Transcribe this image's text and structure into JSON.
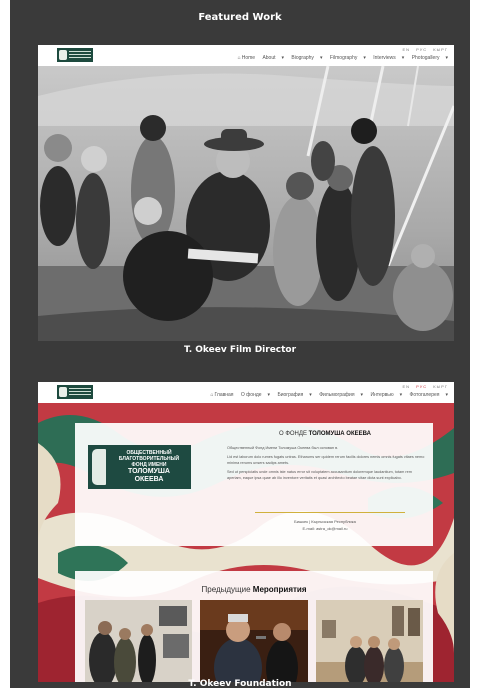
{
  "section_title": "Featured Work",
  "projects": [
    {
      "caption": "T. Okeev Film Director",
      "languages": [
        "EN",
        "РУС",
        "КЫРГ"
      ],
      "nav": [
        "Home",
        "About",
        "Biography",
        "Filmography",
        "Interviews",
        "Photogallery"
      ]
    },
    {
      "caption": "T. Okeev Foundation",
      "languages": [
        "EN",
        "РУС",
        "КЫРГ"
      ],
      "nav": [
        "Главная",
        "О фонде",
        "Биография",
        "Фильмография",
        "Интервью",
        "Фотогалерея"
      ],
      "fund_logo": {
        "line1": "ОБЩЕСТВЕННЫЙ",
        "line2": "БЛАГОТВОРИТЕЛЬНЫЙ",
        "line3": "ФОНД ИМЕНИ",
        "line4": "ТОЛОМУША",
        "line5": "ОКЕЕВА"
      },
      "about_title_prefix": "О ФОНДЕ",
      "about_title_name": "ТОЛОМУША ОКЕЕВА",
      "about_paragraphs": [
        "Общественный Фонд Имени Толомуша Океева был основан в.",
        "Lid est laborum dolo rumes fugats untras. Etharums ser quidem rerum facilis dolores nemis omnis fugats vitaes nemo minima rerums unsers sadips amets.",
        "Sed ut perspiciatis unde omnis iste natus error sit voluptatem accusantium doloremque laudantium, totam rem aperiam, eaque ipsa quae ab illo inventore veritatis et quasi architecto beatae vitae dicta sunt explicabo."
      ],
      "contact_city": "Бишкек | Кыргызская Республика",
      "contact_email": "E-mail: astra_ok@mail.ru",
      "events_title_prefix": "Предыдущие",
      "events_title_bold": "Мероприятия"
    }
  ],
  "colors": {
    "panel": "#3a3a3a",
    "brand_green": "#1d4a3e",
    "accent_red": "#c62f3a",
    "divider_gold": "#d0b13c"
  }
}
